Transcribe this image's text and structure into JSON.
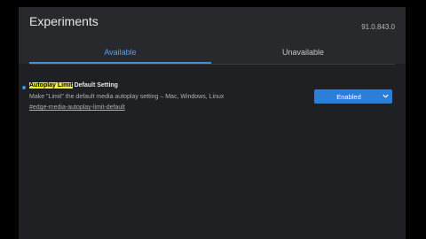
{
  "header": {
    "title": "Experiments",
    "version": "91.0.843.0"
  },
  "tabs": [
    {
      "label": "Available",
      "active": true
    },
    {
      "label": "Unavailable",
      "active": false
    }
  ],
  "flag": {
    "name_highlight": "Autoplay Limit",
    "name_rest": " Default Setting",
    "description": "Make \"Limit\" the default media autoplay setting – Mac, Windows, Linux",
    "link": "#edge-media-autoplay-limit-default",
    "select_value": "Enabled",
    "icon": "chevron-down-icon"
  },
  "colors": {
    "accent": "#3b8fe6",
    "highlight": "#f5f03a",
    "select_bg": "#2b7fd9"
  }
}
